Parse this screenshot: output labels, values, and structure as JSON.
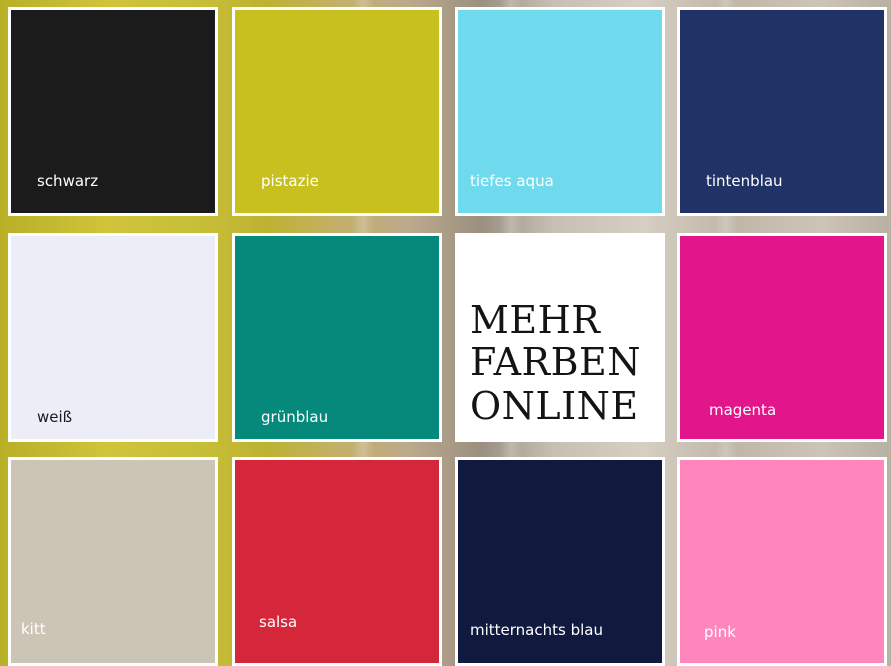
{
  "swatches": [
    {
      "label": "schwarz",
      "color": "#1b1b1b",
      "text_color": "#ffffff"
    },
    {
      "label": "pistazie",
      "color": "#c8c01e",
      "text_color": "#ffffff"
    },
    {
      "label": "tiefes aqua",
      "color": "#6fdaee",
      "text_color": "#ffffff"
    },
    {
      "label": "tintenblau",
      "color": "#213266",
      "text_color": "#ffffff"
    },
    {
      "label": "weiß",
      "color": "#ecedf6",
      "text_color": "#1a1a1a"
    },
    {
      "label": "grünblau",
      "color": "#04897b",
      "text_color": "#ffffff"
    },
    {
      "label": "magenta",
      "color": "#e2158b",
      "text_color": "#ffffff"
    },
    {
      "label": "kitt",
      "color": "#ccc5b6",
      "text_color": "#ffffff"
    },
    {
      "label": "salsa",
      "color": "#d4273a",
      "text_color": "#ffffff"
    },
    {
      "label": "mitternachts blau",
      "color": "#101a3f",
      "text_color": "#ffffff"
    },
    {
      "label": "pink",
      "color": "#ff86bc",
      "text_color": "#ffffff"
    }
  ],
  "promo": {
    "line1": "MEHR",
    "line2": "FARBEN",
    "line3": "ONLINE"
  }
}
